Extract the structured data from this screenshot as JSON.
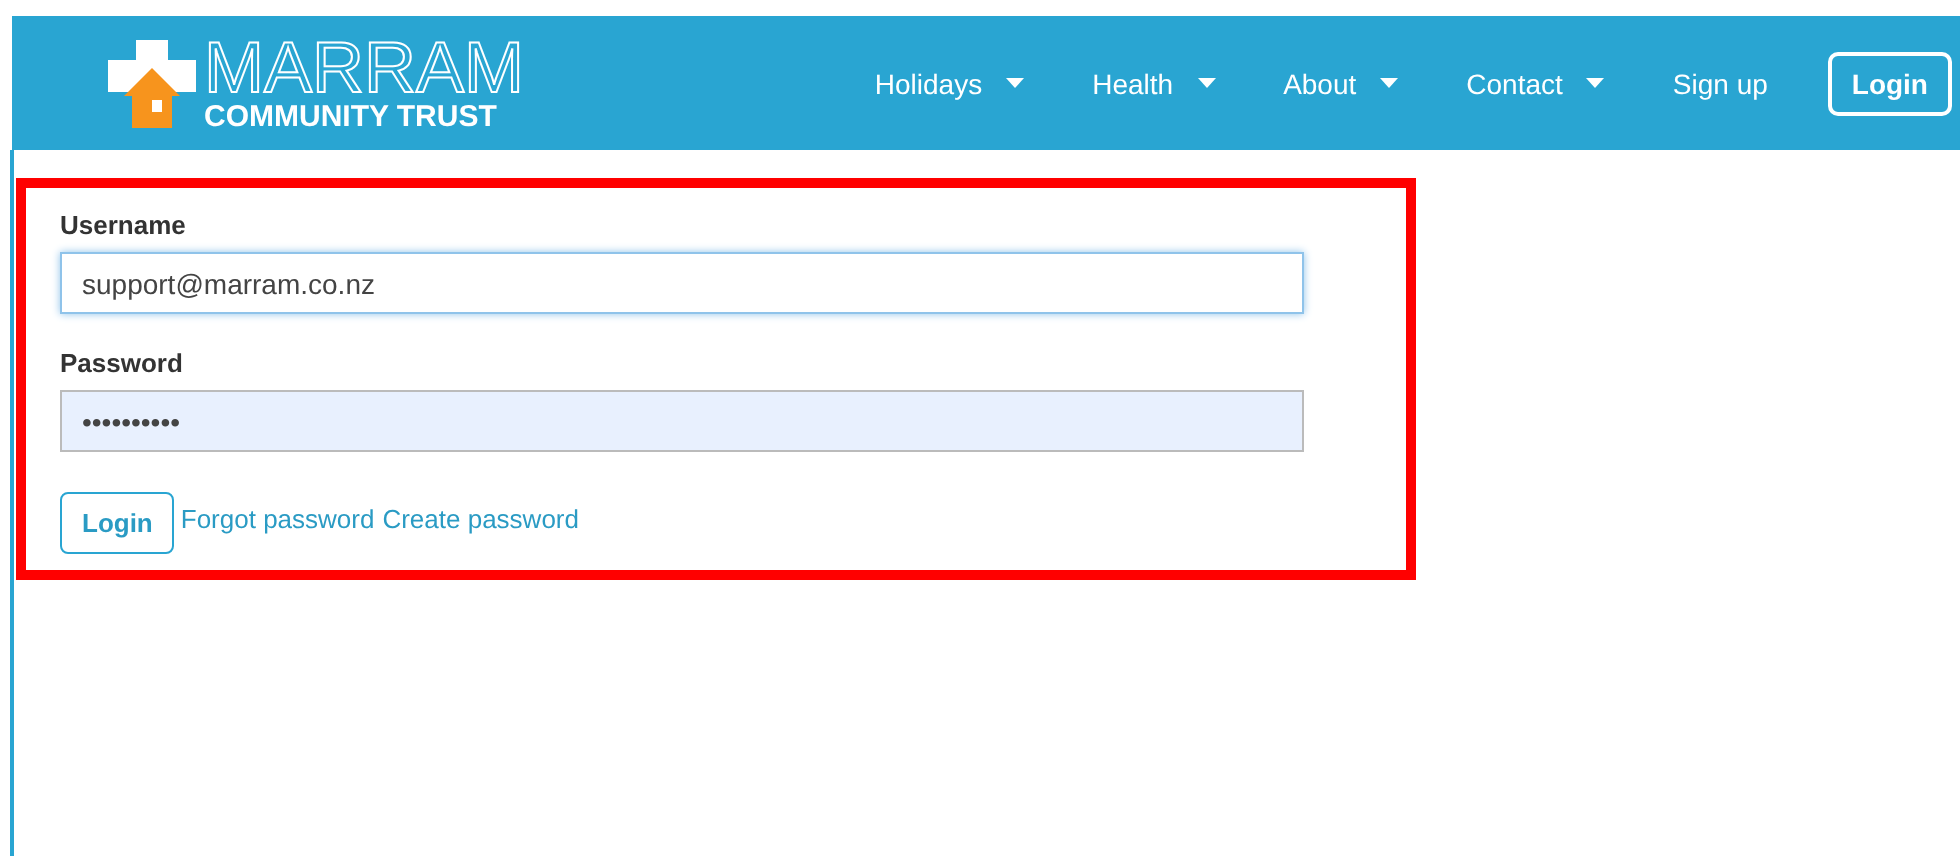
{
  "brand": {
    "title": "MARRAM",
    "subtitle": "COMMUNITY TRUST"
  },
  "nav": [
    {
      "label": "Holidays",
      "dropdown": true
    },
    {
      "label": "Health",
      "dropdown": true
    },
    {
      "label": "About",
      "dropdown": true
    },
    {
      "label": "Contact",
      "dropdown": true
    },
    {
      "label": "Sign up",
      "dropdown": false
    }
  ],
  "nav_login": "Login",
  "form": {
    "fields": [
      {
        "label": "Username",
        "value": "support@marram.co.nz",
        "focused": true
      },
      {
        "label": "Password",
        "value": "••••••••••",
        "focused": false
      }
    ],
    "submit": "Login",
    "links": [
      "Forgot password",
      "Create password"
    ]
  }
}
